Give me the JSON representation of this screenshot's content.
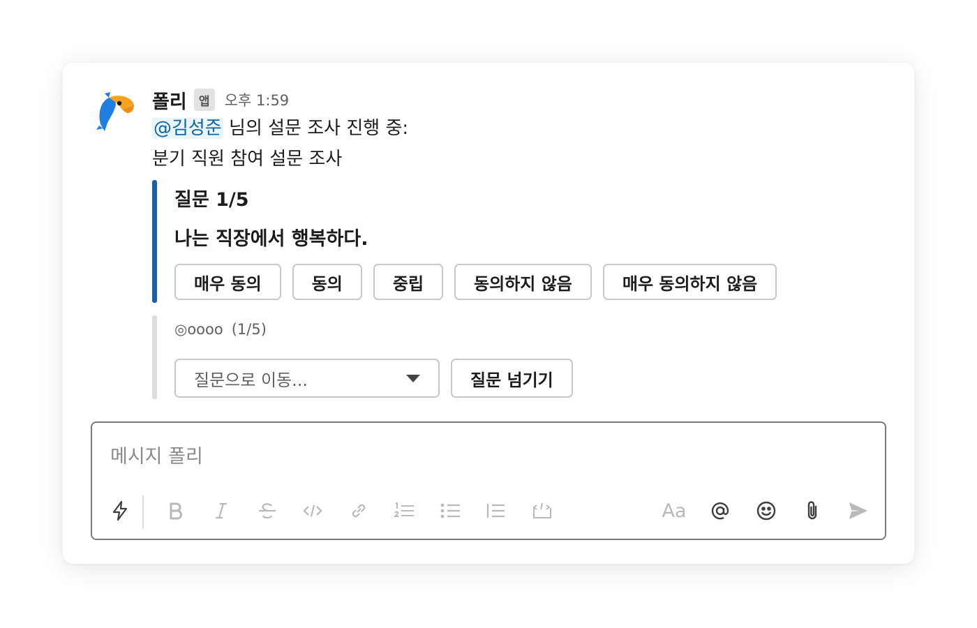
{
  "message": {
    "sender": "폴리",
    "app_badge": "앱",
    "timestamp": "오후 1:59",
    "mention": "@김성준",
    "intro_rest": " 님의 설문 조사 진행 중:",
    "survey_title": "분기 직원 참여 설문 조사"
  },
  "question": {
    "number": "질문 1/5",
    "text": "나는 직장에서 행복하다.",
    "options": [
      "매우 동의",
      "동의",
      "중립",
      "동의하지 않음",
      "매우 동의하지 않음"
    ]
  },
  "progress": {
    "dots": "◎oooo",
    "count": "(1/5)",
    "current": 1,
    "total": 5
  },
  "navigation": {
    "jump_placeholder": "질문으로 이동...",
    "skip_label": "질문 넘기기"
  },
  "composer": {
    "placeholder": "메시지 폴리",
    "format_label": "Aa"
  },
  "colors": {
    "accent_bar": "#1b5fa8",
    "mention": "#1264a3",
    "logo_blue": "#1f7fe0",
    "logo_orange": "#f7a21b"
  },
  "icons": [
    "shortcuts-icon",
    "bold-icon",
    "italic-icon",
    "strikethrough-icon",
    "code-icon",
    "link-icon",
    "numbered-list-icon",
    "bulleted-list-icon",
    "blockquote-icon",
    "code-block-icon",
    "format-icon",
    "mention-icon",
    "emoji-icon",
    "attachment-icon",
    "send-icon"
  ]
}
